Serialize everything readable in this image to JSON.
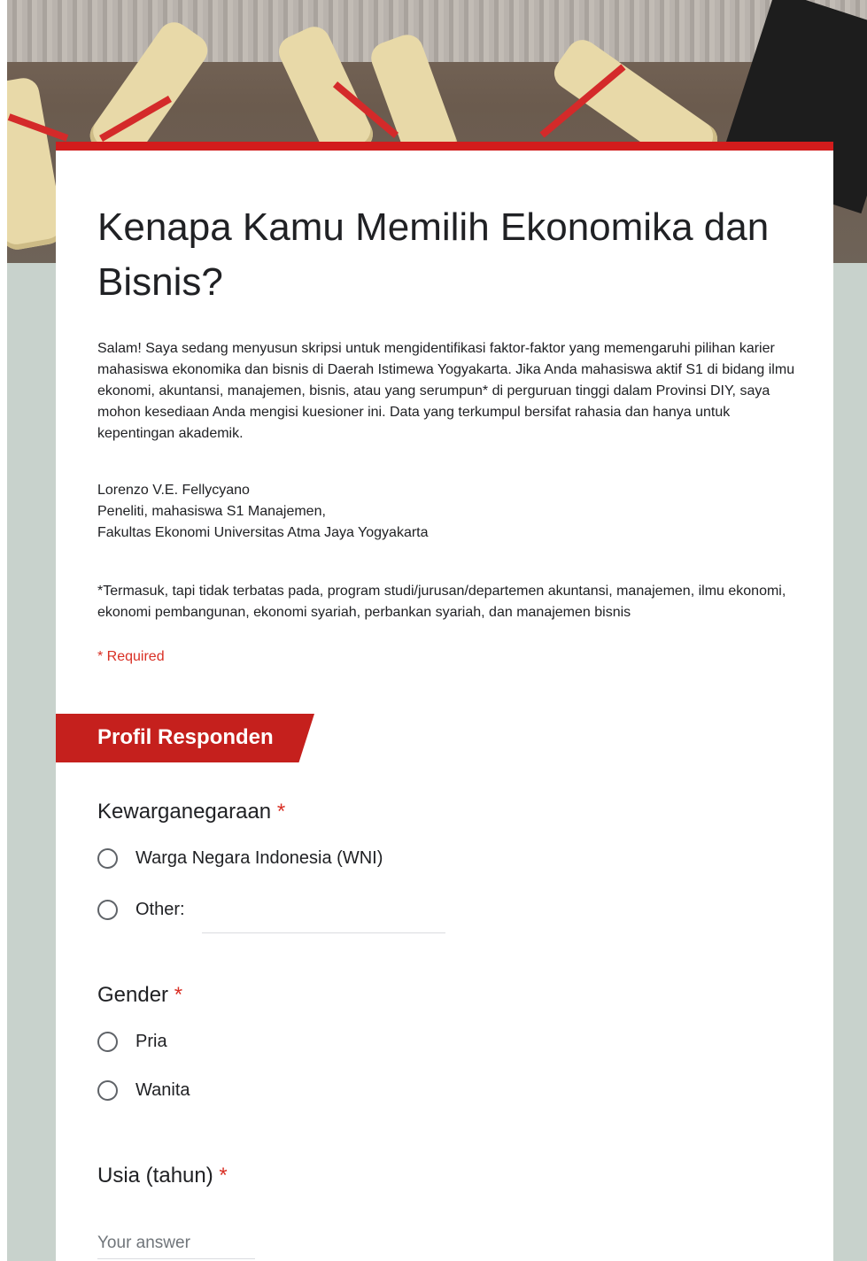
{
  "form": {
    "title": "Kenapa Kamu Memilih Ekonomika dan Bisnis?",
    "description": "Salam! Saya sedang menyusun skripsi untuk mengidentifikasi faktor-faktor yang memengaruhi pilihan karier mahasiswa ekonomika dan bisnis di Daerah Istimewa Yogyakarta. Jika Anda mahasiswa aktif S1 di bidang ilmu ekonomi, akuntansi, manajemen, bisnis, atau yang serumpun* di perguruan tinggi dalam Provinsi DIY, saya mohon kesediaan Anda mengisi kuesioner ini. Data yang terkumpul bersifat rahasia dan hanya untuk kepentingan akademik.",
    "author_lines": [
      "Lorenzo V.E. Fellycyano",
      "Peneliti, mahasiswa S1 Manajemen,",
      "Fakultas Ekonomi Universitas Atma Jaya Yogyakarta"
    ],
    "footnote": "*Termasuk, tapi tidak terbatas pada, program studi/jurusan/departemen akuntansi, manajemen, ilmu ekonomi, ekonomi pembangunan, ekonomi syariah, perbankan syariah, dan manajemen bisnis",
    "required_note": "* Required"
  },
  "section": {
    "title": "Profil Responden"
  },
  "questions": {
    "citizenship": {
      "label": "Kewarganegaraan",
      "required_mark": "*",
      "options": [
        "Warga Negara Indonesia (WNI)",
        "Other:"
      ]
    },
    "gender": {
      "label": "Gender",
      "required_mark": "*",
      "options": [
        "Pria",
        "Wanita"
      ]
    },
    "age": {
      "label": "Usia (tahun)",
      "required_mark": "*",
      "placeholder": "Your answer"
    }
  },
  "colors": {
    "accent": "#d21c1c",
    "section_header": "#c5201d",
    "required": "#d93025",
    "background": "#c8d2cc"
  }
}
